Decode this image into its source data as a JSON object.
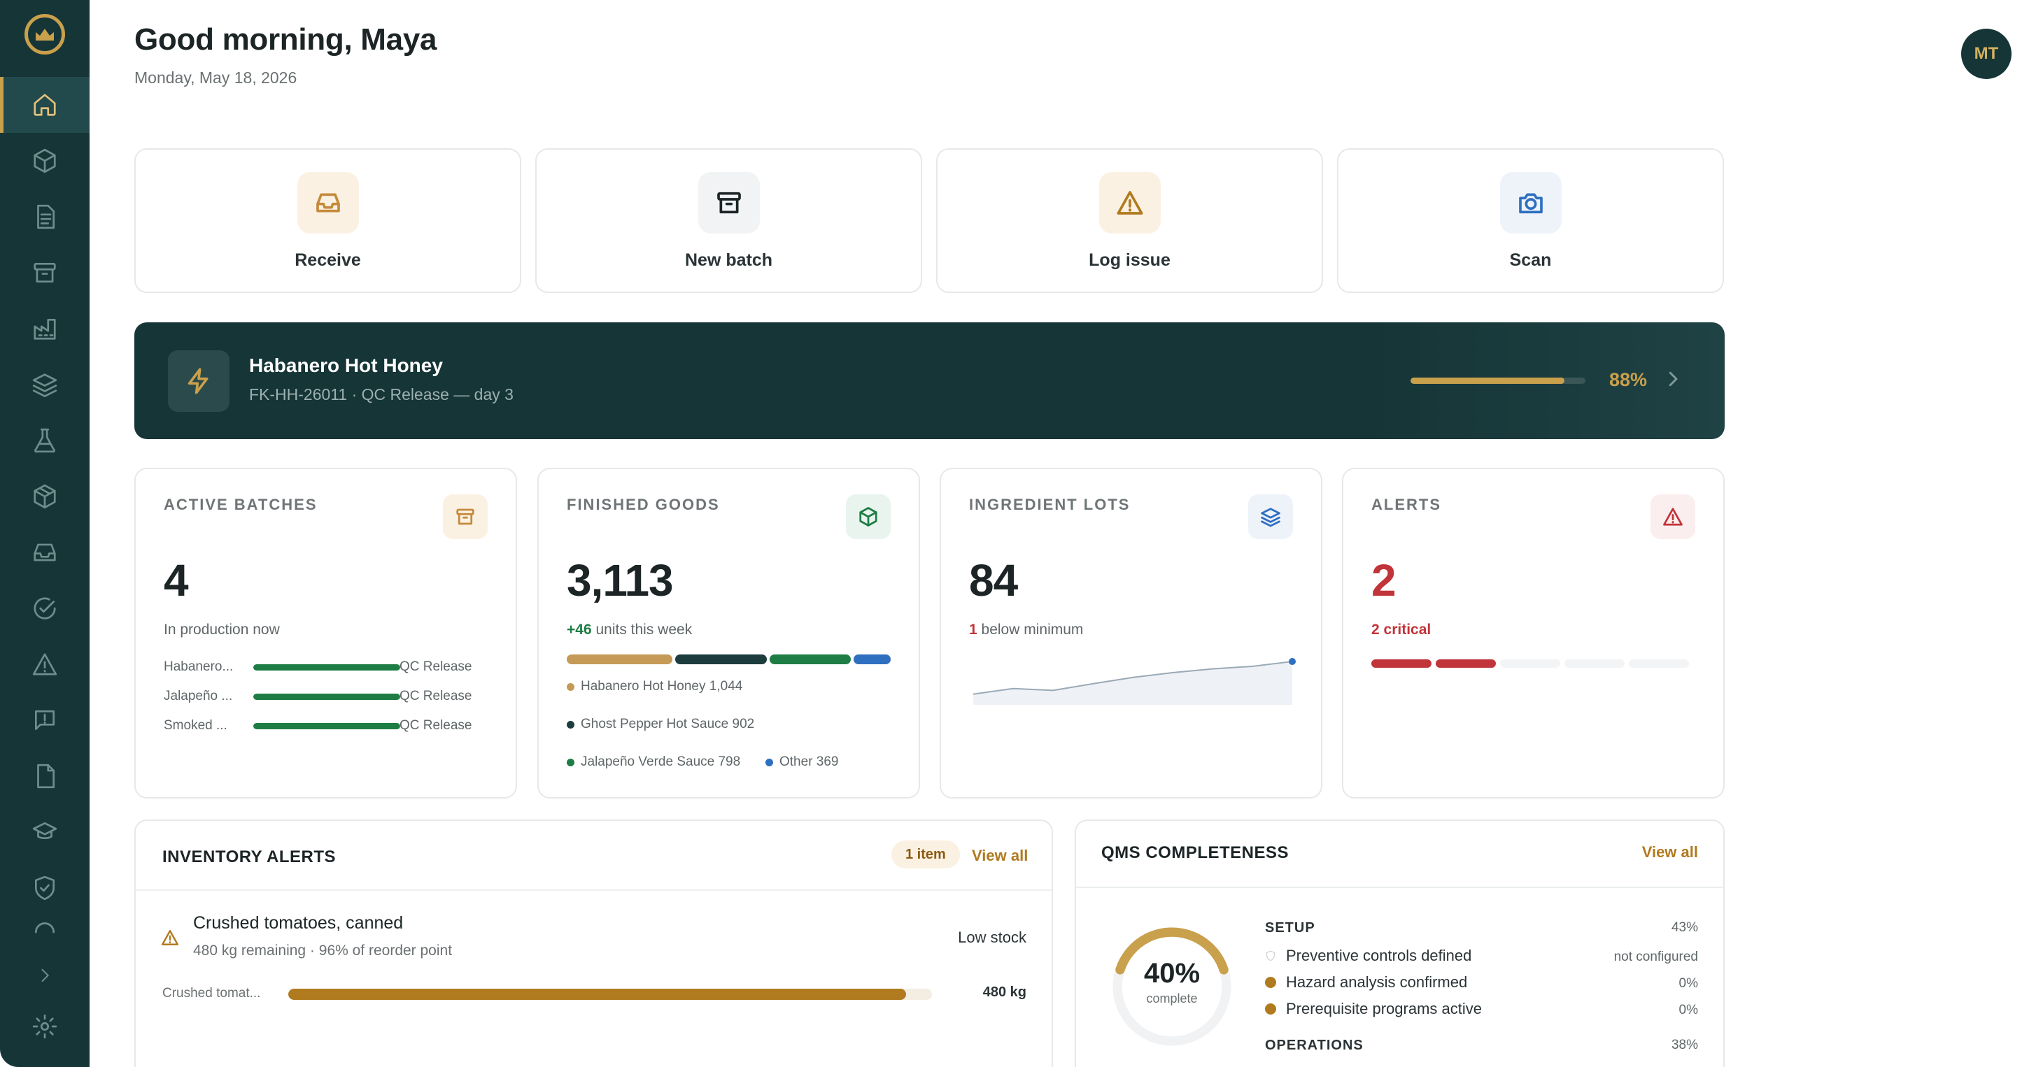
{
  "header": {
    "greeting": "Good morning, Maya",
    "date": "Monday, May 18, 2026",
    "avatar_initials": "MT"
  },
  "sidebar": {
    "items": [
      {
        "icon": "home-icon",
        "active": true
      },
      {
        "icon": "box-icon"
      },
      {
        "icon": "document-icon"
      },
      {
        "icon": "archive-icon"
      },
      {
        "icon": "factory-icon"
      },
      {
        "icon": "layers-icon"
      },
      {
        "icon": "flask-icon"
      },
      {
        "icon": "package-icon"
      },
      {
        "icon": "inbox-icon"
      },
      {
        "icon": "check-circle-icon"
      },
      {
        "icon": "warning-icon"
      },
      {
        "icon": "message-alert-icon"
      },
      {
        "icon": "file-icon"
      },
      {
        "icon": "graduation-cap-icon"
      },
      {
        "icon": "shield-check-icon"
      },
      {
        "icon": "spinner-icon"
      },
      {
        "icon": "chevron-right-icon"
      },
      {
        "icon": "settings-icon"
      }
    ]
  },
  "quick_actions": [
    {
      "label": "Receive",
      "icon": "inbox-icon"
    },
    {
      "label": "New batch",
      "icon": "archive-icon"
    },
    {
      "label": "Log issue",
      "icon": "warning-icon"
    },
    {
      "label": "Scan",
      "icon": "camera-icon"
    }
  ],
  "current_batch": {
    "title": "Habanero Hot Honey",
    "subtitle": "FK-HH-26011 · QC Release — day 3",
    "progress": 0.88,
    "progress_label": "88%"
  },
  "stats": {
    "active_batches": {
      "label": "ACTIVE BATCHES",
      "value": "4",
      "sub": "In production now",
      "rows": [
        {
          "name": "Habanero...",
          "stage": "QC Release",
          "progress": 1.0
        },
        {
          "name": "Jalapeño ...",
          "stage": "QC Release",
          "progress": 1.0
        },
        {
          "name": "Smoked ...",
          "stage": "QC Release",
          "progress": 1.0
        }
      ]
    },
    "finished_goods": {
      "label": "FINISHED GOODS",
      "value": "3,113",
      "delta": "+46",
      "sub": "units this week",
      "segments": [
        {
          "name": "Habanero Hot Honey",
          "value": 1044,
          "text": "Habanero Hot Honey 1,044",
          "color": "#c59a56"
        },
        {
          "name": "Ghost Pepper Hot Sauce",
          "value": 902,
          "text": "Ghost Pepper Hot Sauce 902",
          "color": "#1d3c3e"
        },
        {
          "name": "Jalapeño Verde Sauce",
          "value": 798,
          "text": "Jalapeño Verde Sauce 798",
          "color": "#1e7d44"
        },
        {
          "name": "Other",
          "value": 369,
          "text": "Other 369",
          "color": "#2f6fc0"
        }
      ]
    },
    "ingredient_lots": {
      "label": "INGREDIENT LOTS",
      "value": "84",
      "count": "1",
      "sub": "below minimum",
      "spark": [
        0.1,
        0.25,
        0.2,
        0.38,
        0.55,
        0.68,
        0.78,
        0.85,
        0.98
      ]
    },
    "alerts": {
      "label": "ALERTS",
      "value": "2",
      "sub": "2 critical",
      "segments": [
        {
          "level": "critical"
        },
        {
          "level": "critical"
        },
        {
          "level": "none"
        },
        {
          "level": "none"
        },
        {
          "level": "none"
        }
      ]
    }
  },
  "inventory_alerts": {
    "title": "INVENTORY ALERTS",
    "count_badge": "1 item",
    "view_all": "View all",
    "item": {
      "name": "Crushed tomatoes, canned",
      "detail": "480 kg remaining · 96% of reorder point",
      "status": "Low stock",
      "bar_label": "Crushed tomat...",
      "bar_fill": 0.96,
      "amount": "480 kg"
    }
  },
  "qms": {
    "title": "QMS COMPLETENESS",
    "view_all": "View all",
    "percent": 0.4,
    "percent_label": "40%",
    "complete_label": "complete",
    "sections": [
      {
        "name": "SETUP",
        "pct": "43%",
        "items": [
          {
            "label": "Preventive controls defined",
            "value": "not configured",
            "status": "none"
          },
          {
            "label": "Hazard analysis confirmed",
            "value": "0%",
            "status": "warn"
          },
          {
            "label": "Prerequisite programs active",
            "value": "0%",
            "status": "warn"
          }
        ]
      },
      {
        "name": "OPERATIONS",
        "pct": "38%"
      }
    ]
  },
  "colors": {
    "sidebar": "#163537",
    "accent": "#c9a04c",
    "green": "#1e7d44",
    "red": "#c0343a",
    "amber": "#b07a1f",
    "blue": "#2f6fc0"
  }
}
